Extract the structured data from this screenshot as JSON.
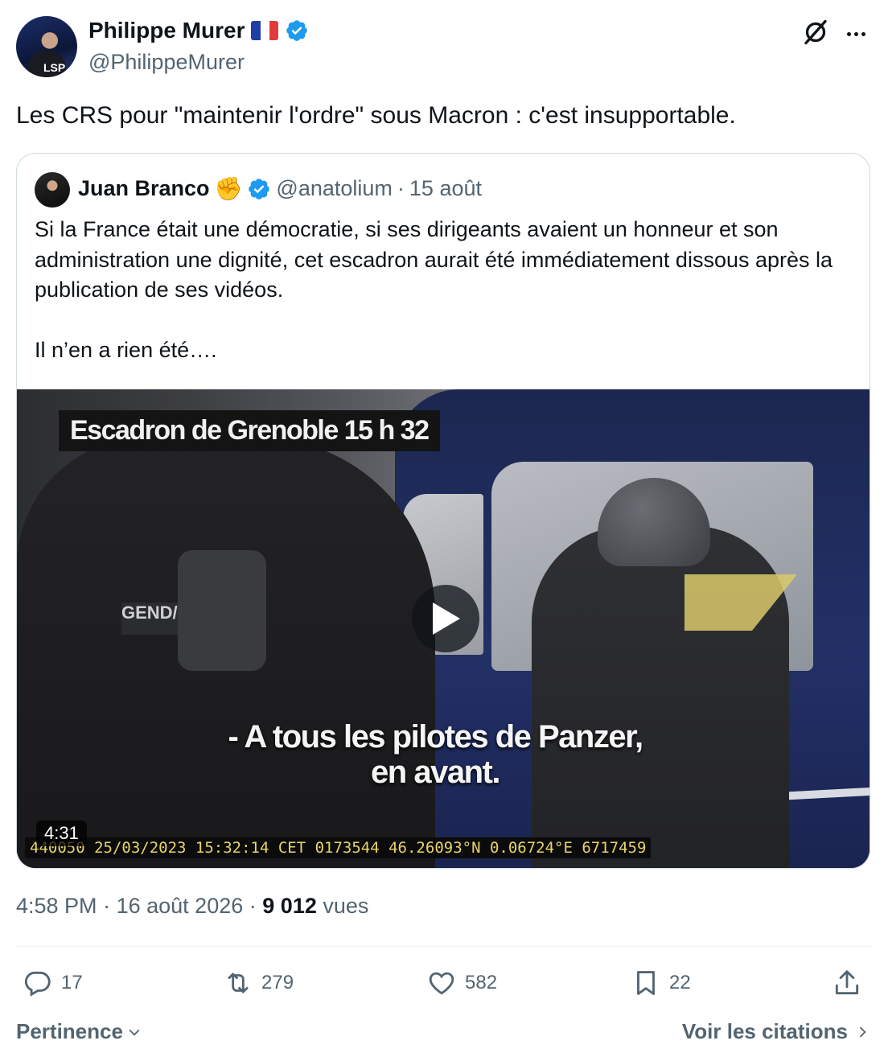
{
  "author": {
    "display_name": "Philippe Murer",
    "flag": "french-flag",
    "verified": true,
    "handle": "@PhilippeMurer"
  },
  "tweet": {
    "text": "Les CRS pour \"maintenir l'ordre\" sous Macron : c'est insupportable."
  },
  "quoted_tweet": {
    "display_name": "Juan Branco",
    "emoji": "✊",
    "verified": true,
    "handle": "@anatolium",
    "separator": "·",
    "date": "15 août",
    "paragraphs": [
      "Si la France était une démocratie, si ses dirigeants avaient un honneur et son administration une dignité, cet escadron aurait été immédiatement dissous après la publication de ses vidéos.",
      "Il n’en a rien été…."
    ],
    "video": {
      "caption": "Escadron de Grenoble 15 h 32",
      "patch_text": "GEND/",
      "subtitle_line1": "- A tous les pilotes de Panzer,",
      "subtitle_line2": "en avant.",
      "duration": "4:31",
      "timecode": "440050 25/03/2023 15:32:14 CET 0173544 46.26093°N 0.06724°E 6717459"
    }
  },
  "meta": {
    "time": "4:58 PM",
    "sep1": "·",
    "date": "16 août 2026",
    "sep2": "·",
    "views_count": "9 012",
    "views_label": "vues"
  },
  "actions": {
    "replies": "17",
    "retweets": "279",
    "likes": "582",
    "bookmarks": "22"
  },
  "footer": {
    "sort_label": "Pertinence",
    "quotes_link": "Voir les citations"
  },
  "colors": {
    "text": "#0f1419",
    "muted": "#536471",
    "verified_blue": "#1d9bf0",
    "border": "#cfd9de"
  }
}
